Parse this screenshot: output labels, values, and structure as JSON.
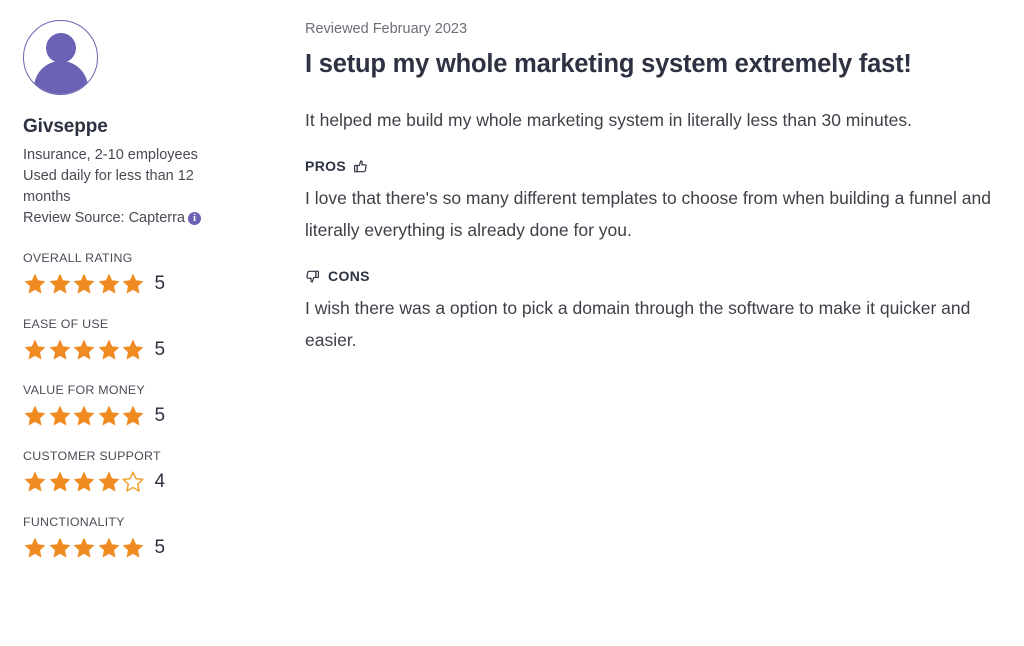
{
  "reviewer": {
    "avatar_alt": "user-avatar",
    "name": "Givseppe",
    "industry_line": "Insurance, 2-10 employees",
    "usage_line": "Used daily for less than 12 months",
    "source_label": "Review Source: Capterra",
    "info_icon_glyph": "i"
  },
  "ratings": [
    {
      "label": "OVERALL RATING",
      "value": "5",
      "filled": 5,
      "total": 5
    },
    {
      "label": "EASE OF USE",
      "value": "5",
      "filled": 5,
      "total": 5
    },
    {
      "label": "VALUE FOR MONEY",
      "value": "5",
      "filled": 5,
      "total": 5
    },
    {
      "label": "CUSTOMER SUPPORT",
      "value": "4",
      "filled": 4,
      "total": 5
    },
    {
      "label": "FUNCTIONALITY",
      "value": "5",
      "filled": 5,
      "total": 5
    }
  ],
  "review": {
    "date": "Reviewed February 2023",
    "title": "I setup my whole marketing system extremely fast!",
    "summary": "It helped me build my whole marketing system in literally less than 30 minutes.",
    "pros_label": "PROS",
    "pros_text": "I love that there's so many different templates to choose from when building a funnel and literally everything is already done for you.",
    "cons_label": "CONS",
    "cons_text": "I wish there was a option to pick a domain through the software to make it quicker and easier."
  },
  "colors": {
    "star_filled": "#f08b22",
    "star_empty_stroke": "#f0a132",
    "avatar_purple": "#6b62b5",
    "title_ink": "#2e3141",
    "body_ink": "#3f3f48",
    "muted": "#6e6e78"
  }
}
